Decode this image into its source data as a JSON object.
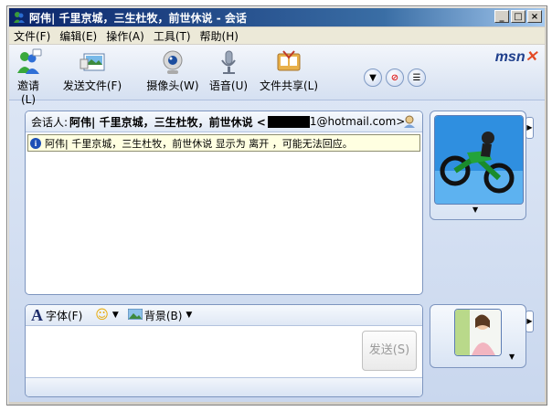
{
  "window": {
    "title": "阿伟| 千里京城，三生杜牧，前世休说 - 会话"
  },
  "menu": [
    "文件(F)",
    "编辑(E)",
    "操作(A)",
    "工具(T)",
    "帮助(H)"
  ],
  "toolbar": {
    "invite": "邀请(L)",
    "send_file": "发送文件(F)",
    "webcam": "摄像头(W)",
    "voice": "语音(U)",
    "share": "文件共享(L)"
  },
  "brand": "msn",
  "conversation": {
    "to_label": "会话人:",
    "to_name": "阿伟| 千里京城，三生杜牧，前世休说 <",
    "to_email_suffix": "1@hotmail.com>",
    "notice": "阿伟| 千里京城，三生杜牧，前世休说 显示为 离开 ，可能无法回应。"
  },
  "compose": {
    "font": "字体(F)",
    "background": "背景(B)",
    "send": "发送(S)"
  }
}
